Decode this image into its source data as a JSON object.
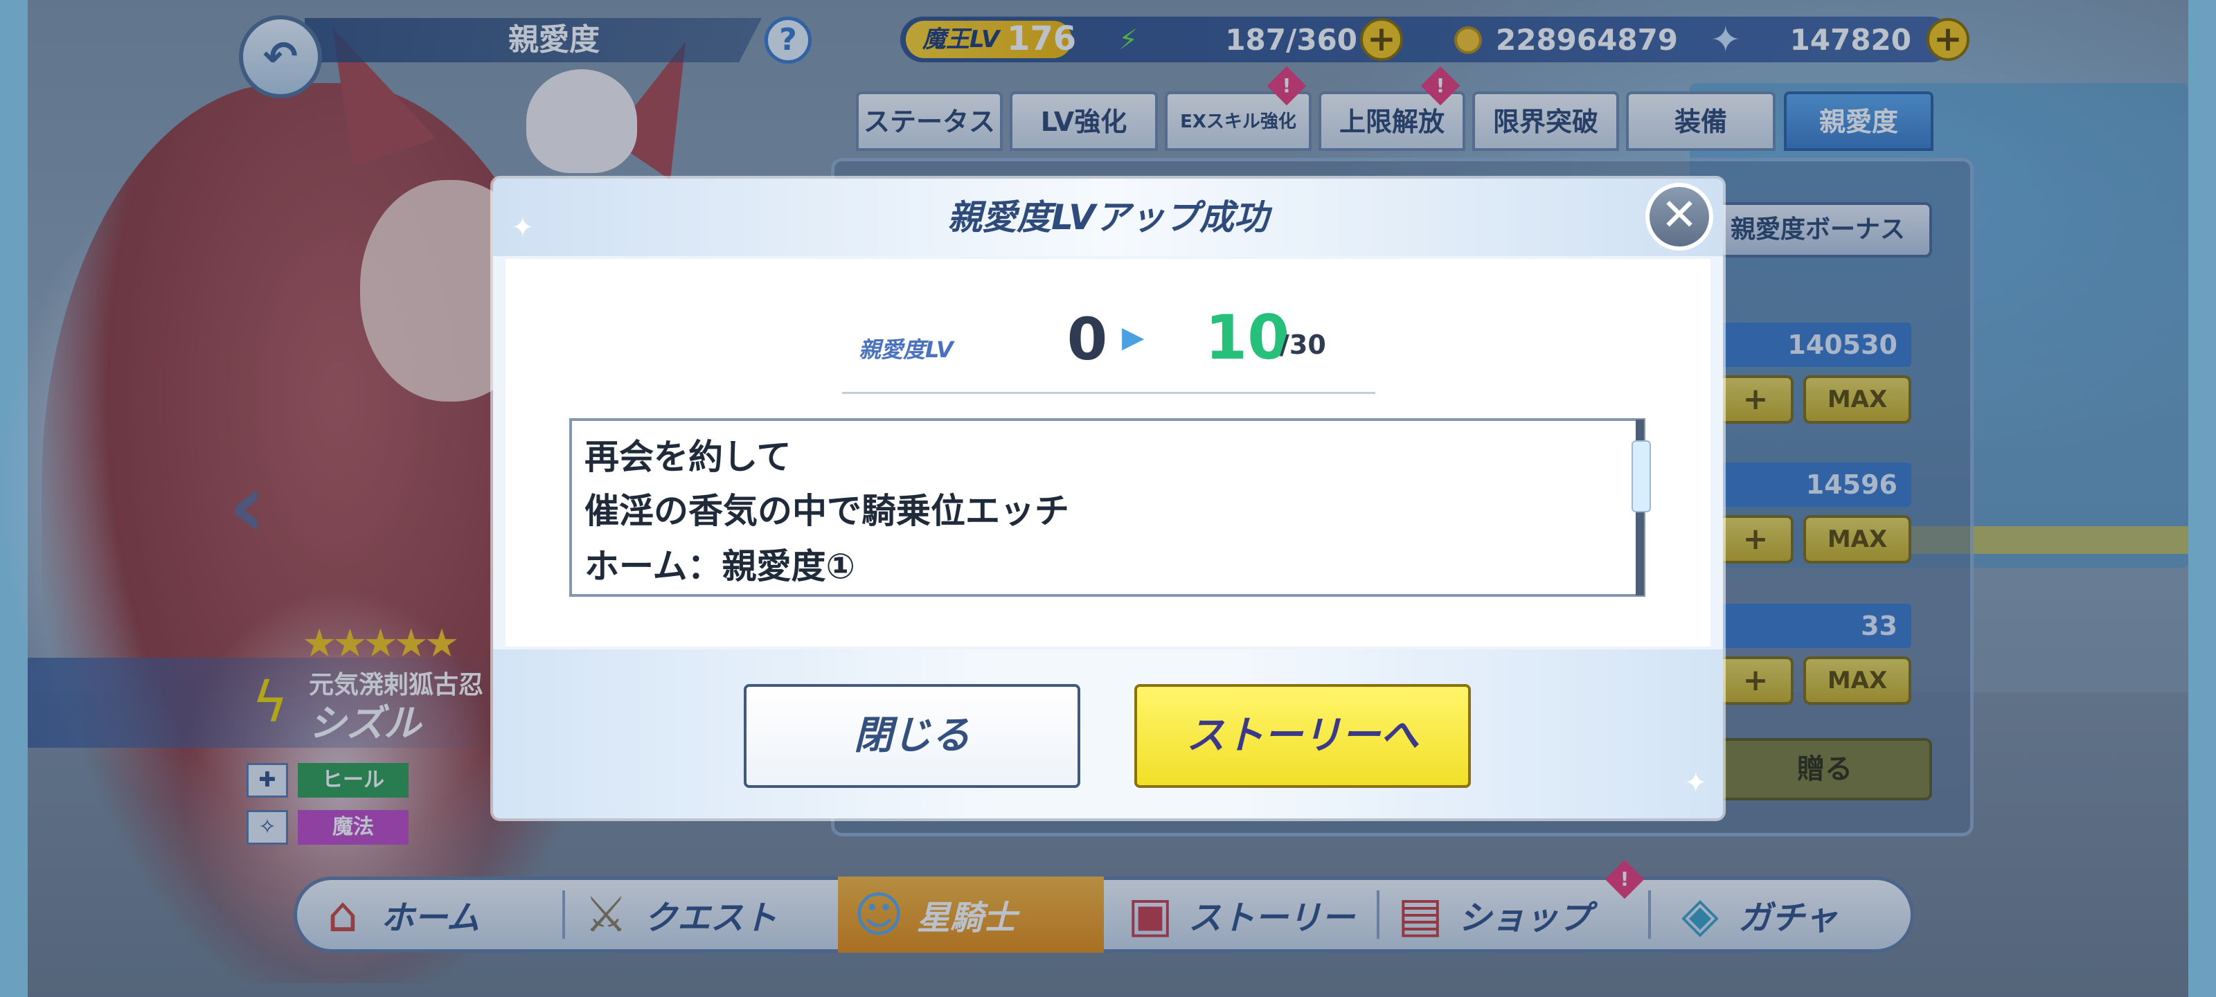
{
  "header": {
    "title": "親愛度",
    "level_label": "魔王LV",
    "level_value": "176",
    "stamina": "187/360",
    "coins": "228964879",
    "gems": "147820"
  },
  "tabs": [
    {
      "label": "ステータス"
    },
    {
      "label": "LV強化"
    },
    {
      "label": "EXスキル強化",
      "alert": "!"
    },
    {
      "label": "上限解放",
      "alert": "!"
    },
    {
      "label": "限界突破"
    },
    {
      "label": "装備"
    },
    {
      "label": "親愛度",
      "active": true
    }
  ],
  "background_panel": {
    "bonus_button": "親愛度ボーナス",
    "stats": [
      {
        "value": "140530",
        "plus": "+",
        "max": "MAX"
      },
      {
        "value": "14596",
        "plus": "+",
        "max": "MAX"
      },
      {
        "value": "33",
        "plus": "+",
        "max": "MAX"
      }
    ],
    "gift_button": "贈る"
  },
  "character": {
    "stars": "★★★★★",
    "title": "元気溌剌狐古忍",
    "name": "シズル",
    "roles": [
      "ヒール",
      "魔法"
    ]
  },
  "modal": {
    "title": "親愛度LVアップ成功",
    "level_label": "親愛度LV",
    "level_old": "0",
    "level_new": "10",
    "level_max": "/30",
    "story_lines": [
      "再会を約して",
      "催淫の香気の中で騎乗位エッチ",
      "ホーム：親愛度①"
    ],
    "close_button": "閉じる",
    "story_button": "ストーリーへ"
  },
  "nav": {
    "items": [
      {
        "label": "ホーム",
        "icon": "home-icon"
      },
      {
        "label": "クエスト",
        "icon": "quest-icon"
      },
      {
        "label": "星騎士",
        "icon": "star-knight-icon",
        "active": true
      },
      {
        "label": "ストーリー",
        "icon": "story-book-icon"
      },
      {
        "label": "ショップ",
        "icon": "shop-icon",
        "alert": "!"
      },
      {
        "label": "ガチャ",
        "icon": "gacha-icon"
      }
    ]
  }
}
